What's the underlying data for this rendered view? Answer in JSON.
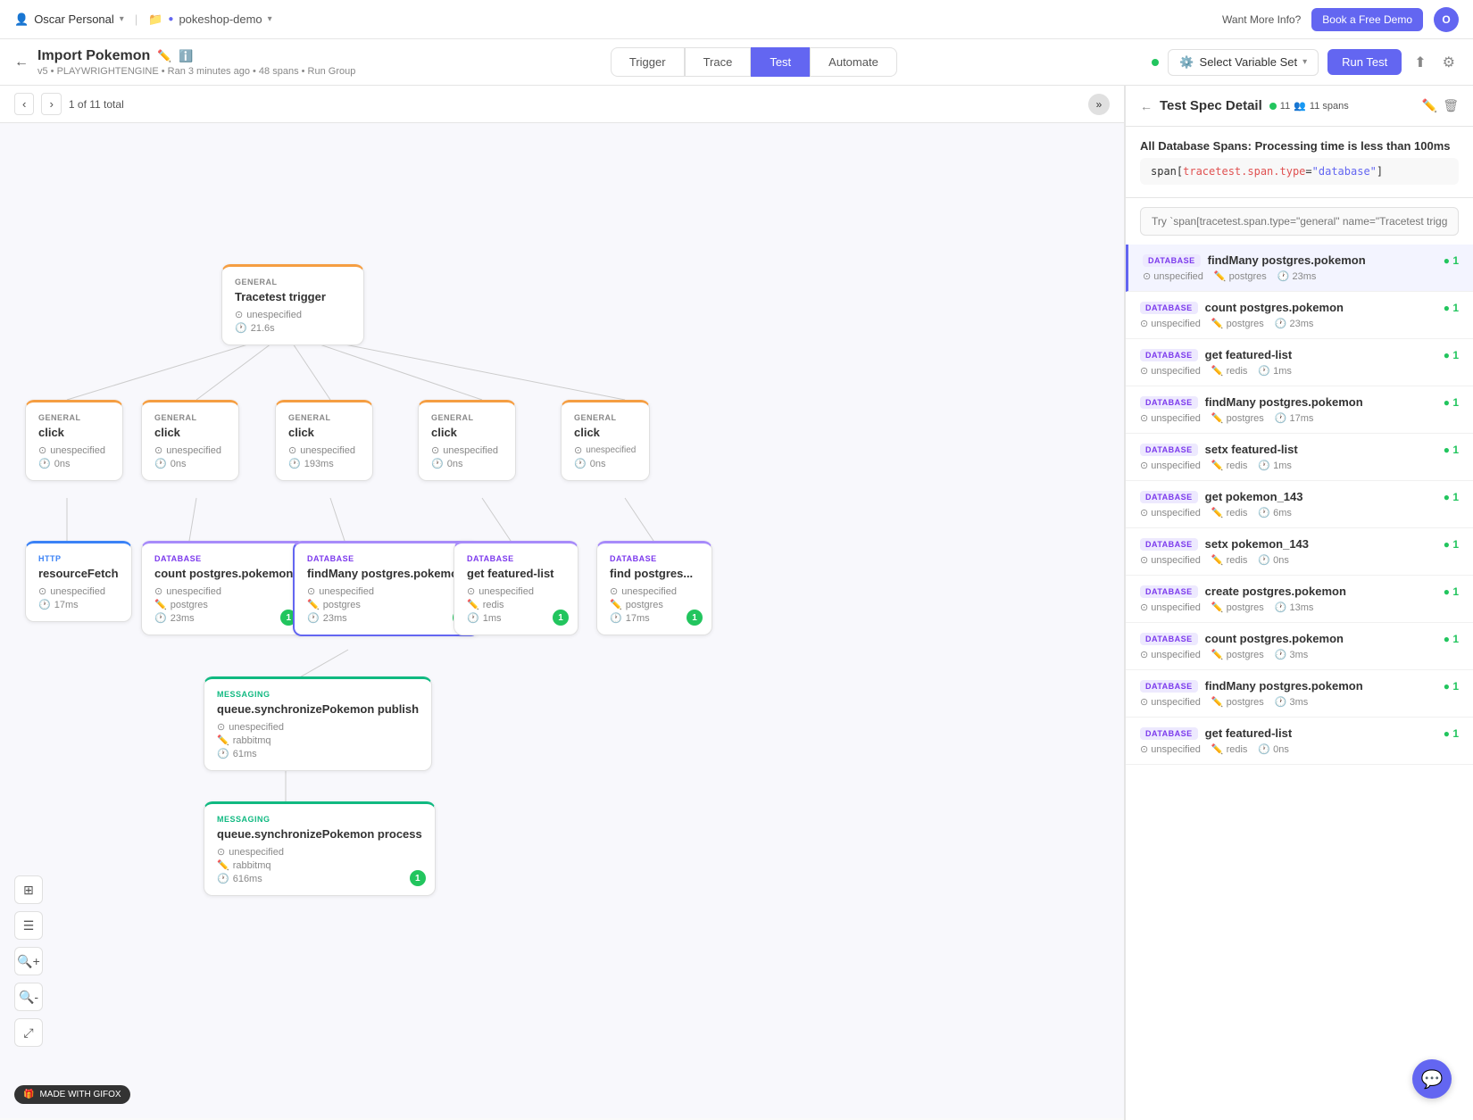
{
  "topNav": {
    "user": "Oscar Personal",
    "project": "pokeshop-demo",
    "wantMore": "Want More Info?",
    "bookFree": "Book a Free Demo",
    "avatarInitial": "O"
  },
  "subHeader": {
    "testTitle": "Import Pokemon",
    "testMeta": "v5 • PLAYWRIGHTENGINE • Ran 3 minutes ago • 48 spans • Run Group",
    "tabs": [
      "Trigger",
      "Trace",
      "Test",
      "Automate"
    ],
    "activeTab": "Test",
    "variableSet": "Select Variable Set",
    "runTest": "Run Test"
  },
  "tracePanel": {
    "pagination": "1 of 11 total"
  },
  "rightPanel": {
    "title": "Test Spec Detail",
    "greenDot": "11",
    "spans": "11 spans",
    "assertionTitle": "All Database Spans: Processing time is less than 100ms",
    "assertionCode": "span[tracetest.span.type=\"database\"]",
    "searchPlaceholder": "Try `span[tracetest.span.type=\"general\" name=\"Tracetest trigger\"]` or just \"Tracetest trigger\"",
    "spanItems": [
      {
        "type": "DATABASE",
        "name": "findMany postgres.pokemon",
        "pass": "1",
        "unspecified": "unspecified",
        "db": "postgres",
        "time": "23ms",
        "active": true
      },
      {
        "type": "DATABASE",
        "name": "count postgres.pokemon",
        "pass": "1",
        "unspecified": "unspecified",
        "db": "postgres",
        "time": "23ms",
        "active": false
      },
      {
        "type": "DATABASE",
        "name": "get featured-list",
        "pass": "1",
        "unspecified": "unspecified",
        "db": "redis",
        "time": "1ms",
        "active": false
      },
      {
        "type": "DATABASE",
        "name": "findMany postgres.pokemon",
        "pass": "1",
        "unspecified": "unspecified",
        "db": "postgres",
        "time": "17ms",
        "active": false
      },
      {
        "type": "DATABASE",
        "name": "setx featured-list",
        "pass": "1",
        "unspecified": "unspecified",
        "db": "redis",
        "time": "1ms",
        "active": false
      },
      {
        "type": "DATABASE",
        "name": "get pokemon_143",
        "pass": "1",
        "unspecified": "unspecified",
        "db": "redis",
        "time": "6ms",
        "active": false
      },
      {
        "type": "DATABASE",
        "name": "setx pokemon_143",
        "pass": "1",
        "unspecified": "unspecified",
        "db": "redis",
        "time": "0ns",
        "active": false
      },
      {
        "type": "DATABASE",
        "name": "create postgres.pokemon",
        "pass": "1",
        "unspecified": "unspecified",
        "db": "postgres",
        "time": "13ms",
        "active": false
      },
      {
        "type": "DATABASE",
        "name": "count postgres.pokemon",
        "pass": "1",
        "unspecified": "unspecified",
        "db": "postgres",
        "time": "3ms",
        "active": false
      },
      {
        "type": "DATABASE",
        "name": "findMany postgres.pokemon",
        "pass": "1",
        "unspecified": "unspecified",
        "db": "postgres",
        "time": "3ms",
        "active": false
      },
      {
        "type": "DATABASE",
        "name": "get featured-list",
        "pass": "1",
        "unspecified": "unspecified",
        "db": "redis",
        "time": "0ns",
        "active": false
      }
    ]
  },
  "nodes": {
    "trigger": {
      "type": "GENERAL",
      "title": "Tracetest trigger",
      "unspecified": "unespecified",
      "time": "21.6s"
    },
    "clicks": [
      {
        "type": "GENERAL",
        "title": "click",
        "unspecified": "unespecified",
        "time": "0ns"
      },
      {
        "type": "GENERAL",
        "title": "click",
        "unspecified": "unespecified",
        "time": "0ns"
      },
      {
        "type": "GENERAL",
        "title": "click",
        "unspecified": "unespecified",
        "time": "193ms"
      },
      {
        "type": "GENERAL",
        "title": "click",
        "unspecified": "unespecified",
        "time": "0ns"
      },
      {
        "type": "GENERAL",
        "title": "click",
        "unspecified": "unespecified",
        "time": "0ns"
      }
    ],
    "databases": [
      {
        "type": "DATABASE",
        "title": "count postgres.pokemon",
        "unspecified": "unespecified",
        "db": "postgres",
        "time": "23ms",
        "badge": "1"
      },
      {
        "type": "DATABASE",
        "title": "findMany postgres.pokemon",
        "unspecified": "unespecified",
        "db": "postgres",
        "time": "23ms",
        "badge": "1"
      },
      {
        "type": "DATABASE",
        "title": "get featured-list",
        "unspecified": "unespecified",
        "db": "redis",
        "time": "1ms",
        "badge": "1"
      },
      {
        "type": "DATABASE",
        "title": "find postgres...",
        "unspecified": "unespecified",
        "db": "postgres",
        "time": "17ms",
        "badge": "1"
      }
    ],
    "messaging1": {
      "type": "MESSAGING",
      "title": "queue.synchronizePokemon publish",
      "unspecified": "unespecified",
      "db": "rabbitmq",
      "time": "61ms"
    },
    "messaging2": {
      "type": "MESSAGING",
      "title": "queue.synchronizePokemon process",
      "unspecified": "unespecified",
      "db": "rabbitmq",
      "time": "616ms",
      "badge": "1"
    },
    "http": {
      "type": "HTTP",
      "title": "resourceFetch",
      "unspecified": "unespecified",
      "time": "17ms"
    }
  }
}
